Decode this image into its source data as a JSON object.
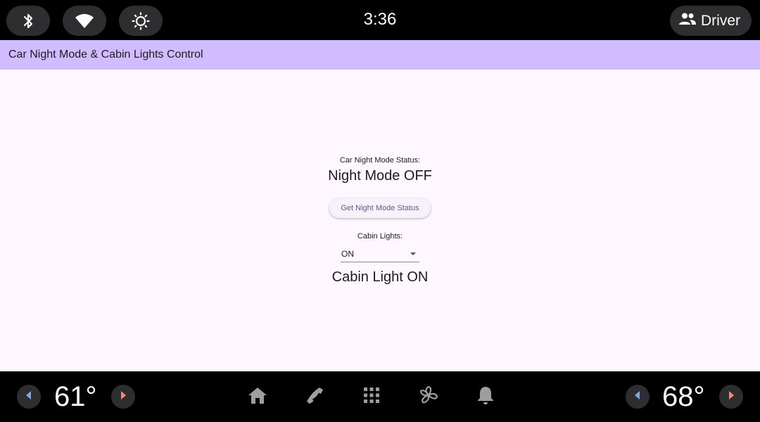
{
  "status_bar": {
    "clock": "3:36",
    "quick_settings": [
      {
        "icon": "bluetooth-icon"
      },
      {
        "icon": "wifi-icon"
      },
      {
        "icon": "brightness-icon"
      }
    ],
    "profile": {
      "icon": "people-icon",
      "label": "Driver"
    }
  },
  "app_bar": {
    "title": "Car Night Mode & Cabin Lights Control"
  },
  "main": {
    "night_mode_label": "Car Night Mode Status:",
    "night_mode_status": "Night Mode OFF",
    "get_status_button": "Get Night Mode Status",
    "cabin_lights_label": "Cabin Lights:",
    "cabin_lights_selected": "ON",
    "cabin_light_status": "Cabin Light ON"
  },
  "nav_bar": {
    "left_temp": "61°",
    "right_temp": "68°",
    "icons": [
      "home-icon",
      "phone-icon",
      "apps-grid-icon",
      "fan-icon",
      "notifications-icon"
    ]
  },
  "colors": {
    "app_bar_bg": "#d0bcff",
    "content_bg": "#fef7ff",
    "button_text": "#65558f",
    "decrease_arrow": "#7fa6e8",
    "increase_arrow": "#e88a80"
  }
}
